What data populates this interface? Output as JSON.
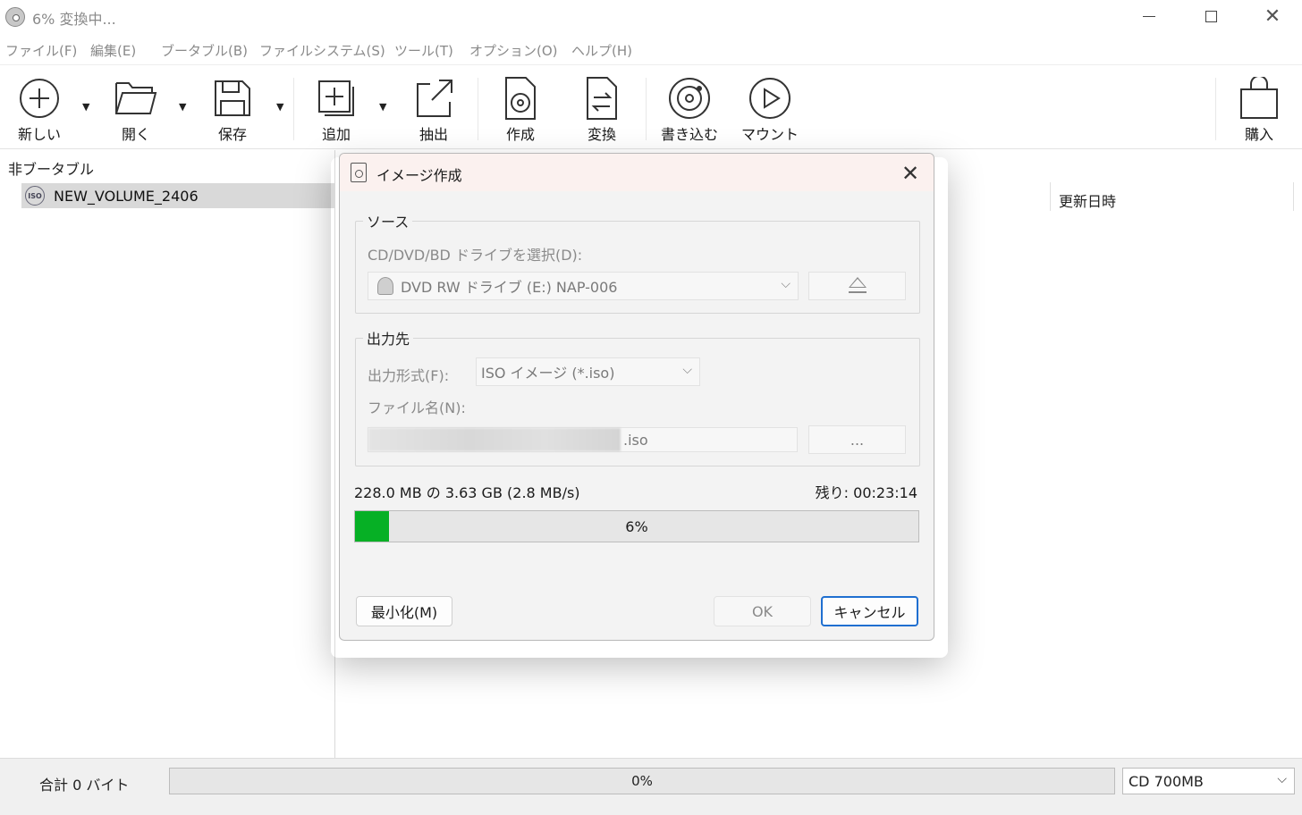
{
  "window": {
    "title": "6% 変換中...",
    "minimize_icon": "minimize-icon",
    "maximize_icon": "maximize-icon",
    "close_icon": "close-icon"
  },
  "menu": {
    "items": [
      "ファイル(F)",
      "編集(E)",
      "ブータブル(B)",
      "ファイルシステム(S)",
      "ツール(T)",
      "オプション(O)",
      "ヘルプ(H)"
    ]
  },
  "toolbar": {
    "new_label": "新しい",
    "open_label": "開く",
    "save_label": "保存",
    "add_label": "追加",
    "extract_label": "抽出",
    "create_label": "作成",
    "convert_label": "変換",
    "burn_label": "書き込む",
    "mount_label": "マウント",
    "buy_label": "購入"
  },
  "left_pane": {
    "header": "非ブータブル",
    "tree_item": "NEW_VOLUME_2406",
    "tree_item_icon_text": "ISO"
  },
  "right_pane": {
    "column_modified": "更新日時"
  },
  "status": {
    "total": "合計 0 バイト",
    "progress_text": "0%",
    "progress_value": 0,
    "media": "CD 700MB"
  },
  "dialog": {
    "title": "イメージ作成",
    "source_legend": "ソース",
    "drive_label": "CD/DVD/BD ドライブを選択(D):",
    "drive_value": "DVD RW ドライブ (E:) NAP-006",
    "output_legend": "出力先",
    "format_label": "出力形式(F):",
    "format_value": "ISO イメージ (*.iso)",
    "filename_label": "ファイル名(N):",
    "filename_ext": ".iso",
    "browse_label": "...",
    "progress_detail": "228.0 MB の 3.63 GB (2.8 MB/s)",
    "remaining": "残り: 00:23:14",
    "percent_text": "6%",
    "percent_value": 6,
    "minimize_button": "最小化(M)",
    "ok_button": "OK",
    "cancel_button": "キャンセル",
    "accent_color": "#06b025",
    "focus_color": "#1f6fd0"
  }
}
